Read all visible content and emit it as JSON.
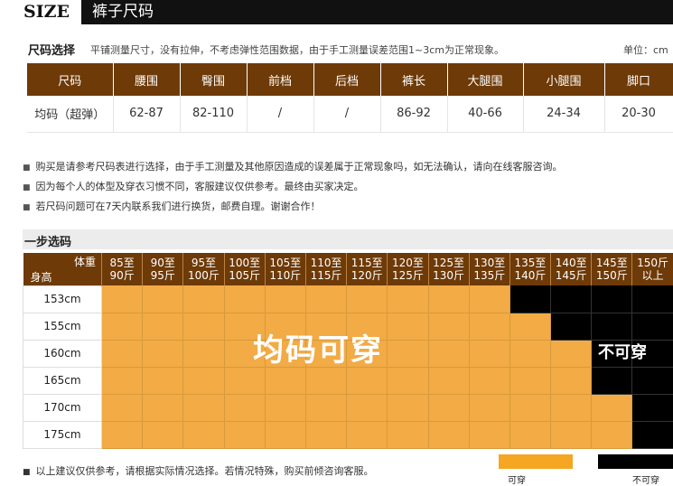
{
  "header": {
    "size_label": "SIZE",
    "title": "裤子尺码"
  },
  "intro": {
    "title": "尺码选择",
    "note": "平铺测量尺寸，没有拉伸，不考虑弹性范围数据，由于手工测量误差范围1~3cm为正常现象。",
    "unit": "单位：cm"
  },
  "size_table": {
    "headers": [
      "尺码",
      "腰围",
      "臀围",
      "前档",
      "后档",
      "裤长",
      "大腿围",
      "小腿围",
      "脚口"
    ],
    "row": [
      "均码（超弹）",
      "62-87",
      "82-110",
      "/",
      "/",
      "86-92",
      "40-66",
      "24-34",
      "20-30"
    ]
  },
  "notes": [
    "购买是请参考尺码表进行选择，由于手工测量及其他原因造成的误差属于正常现象吗，如无法确认，请向在线客服咨询。",
    "因为每个人的体型及穿衣习惯不同，客服建议仅供参考。最终由买家决定。",
    "若尺码问题可在7天内联系我们进行换货，邮费自理。谢谢合作！"
  ],
  "step": {
    "title": "一步选码",
    "corner_weight": "体重",
    "corner_height": "身高",
    "weights": [
      [
        "85至",
        "90斤"
      ],
      [
        "90至",
        "95斤"
      ],
      [
        "95至",
        "100斤"
      ],
      [
        "100至",
        "105斤"
      ],
      [
        "105至",
        "110斤"
      ],
      [
        "110至",
        "115斤"
      ],
      [
        "115至",
        "120斤"
      ],
      [
        "120至",
        "125斤"
      ],
      [
        "125至",
        "130斤"
      ],
      [
        "130至",
        "135斤"
      ],
      [
        "135至",
        "140斤"
      ],
      [
        "140至",
        "145斤"
      ],
      [
        "145至",
        "150斤"
      ],
      [
        "150斤",
        "以上"
      ]
    ],
    "heights": [
      "153cm",
      "155cm",
      "160cm",
      "165cm",
      "170cm",
      "175cm"
    ],
    "fit_text": "均码可穿",
    "nofit_text": "不可穿"
  },
  "footer": {
    "note": "以上建议仅供参考，请根据实际情况选择。若情况特殊，购买前倾咨询客服。",
    "legend_fit": "可穿",
    "legend_nofit": "不可穿"
  },
  "colors": {
    "header_brown": "#6e3a07",
    "fit_orange": "#f2ab45",
    "nofit_black": "#000000"
  }
}
